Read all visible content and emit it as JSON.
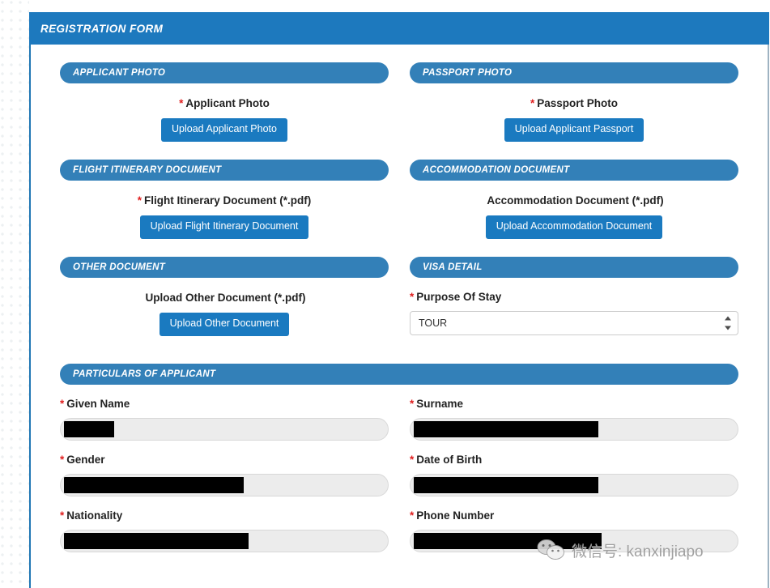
{
  "page": {
    "title": "REGISTRATION FORM"
  },
  "colors": {
    "title_bar_blue": "#1d79be",
    "pill_header_blue": "#3380b8",
    "button_blue": "#1a7ac0",
    "required_red": "#e02020",
    "input_fill": "#ececec",
    "redaction_black": "#000000"
  },
  "sections": {
    "applicant_photo": {
      "header": "APPLICANT PHOTO",
      "label": "Applicant Photo",
      "required": "*",
      "button": "Upload Applicant Photo"
    },
    "passport_photo": {
      "header": "PASSPORT PHOTO",
      "label": "Passport Photo",
      "required": "*",
      "button": "Upload Applicant Passport"
    },
    "flight_itinerary": {
      "header": "FLIGHT ITINERARY DOCUMENT",
      "label": "Flight Itinerary Document (*.pdf)",
      "required": "*",
      "button": "Upload Flight Itinerary Document"
    },
    "accommodation": {
      "header": "ACCOMMODATION DOCUMENT",
      "label": "Accommodation Document (*.pdf)",
      "required": "",
      "button": "Upload Accommodation Document"
    },
    "other_document": {
      "header": "OTHER DOCUMENT",
      "label": "Upload Other Document (*.pdf)",
      "required": "",
      "button": "Upload Other Document"
    },
    "visa_detail": {
      "header": "VISA DETAIL",
      "purpose_label": "Purpose Of Stay",
      "purpose_required": "*",
      "purpose_value": "TOUR"
    },
    "particulars": {
      "header": "PARTICULARS OF APPLICANT",
      "fields": [
        {
          "label": "Given Name",
          "required": "*",
          "value": "",
          "redaction_width": 62
        },
        {
          "label": "Surname",
          "required": "*",
          "value": "",
          "redaction_width": 228
        },
        {
          "label": "Gender",
          "required": "*",
          "value": "",
          "redaction_width": 222
        },
        {
          "label": "Date of Birth",
          "required": "*",
          "value": "",
          "redaction_width": 228
        },
        {
          "label": "Nationality",
          "required": "*",
          "value": "",
          "redaction_width": 228
        },
        {
          "label": "Phone Number",
          "required": "*",
          "value": "",
          "redaction_width": 232
        }
      ]
    }
  },
  "watermark": {
    "text": "微信号: kanxinjiapo",
    "icon": "wechat-icon"
  }
}
